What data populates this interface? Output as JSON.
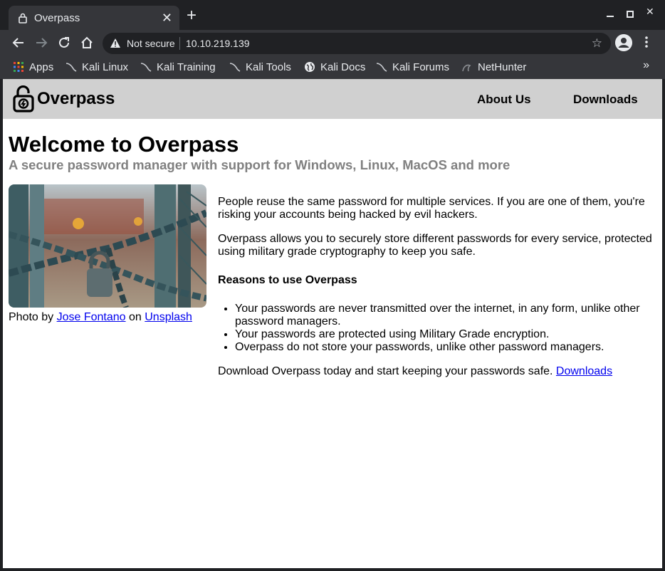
{
  "browser": {
    "tab_title": "Overpass",
    "security_label": "Not secure",
    "url": "10.10.219.139",
    "bookmarks": [
      "Apps",
      "Kali Linux",
      "Kali Training",
      "Kali Tools",
      "Kali Docs",
      "Kali Forums",
      "NetHunter"
    ],
    "bookmarks_overflow": "»"
  },
  "site": {
    "brand": "Overpass",
    "nav": [
      "About Us",
      "Downloads"
    ]
  },
  "page": {
    "title": "Welcome to Overpass",
    "subtitle": "A secure password manager with support for Windows, Linux, MacOS and more",
    "caption": {
      "prefix": "Photo by ",
      "author": "Jose Fontano",
      "middle": " on ",
      "source": "Unsplash"
    },
    "paragraph1": "People reuse the same password for multiple services. If you are one of them, you're risking your accounts being hacked by evil hackers.",
    "paragraph2": "Overpass allows you to securely store different passwords for every service, protected using military grade cryptography to keep you safe.",
    "reasons_heading": "Reasons to use Overpass",
    "reasons": [
      "Your passwords are never transmitted over the internet, in any form, unlike other password managers.",
      "Your passwords are protected using Military Grade encryption.",
      "Overpass do not store your passwords, unlike other password managers."
    ],
    "cta_text": "Download Overpass today and start keeping your passwords safe. ",
    "cta_link": "Downloads"
  },
  "colors": {
    "chrome_dark": "#202124",
    "chrome_toolbar": "#35363a",
    "site_header": "#d0d0d0",
    "subtitle_gray": "#808080",
    "link_blue": "#0000ee"
  }
}
